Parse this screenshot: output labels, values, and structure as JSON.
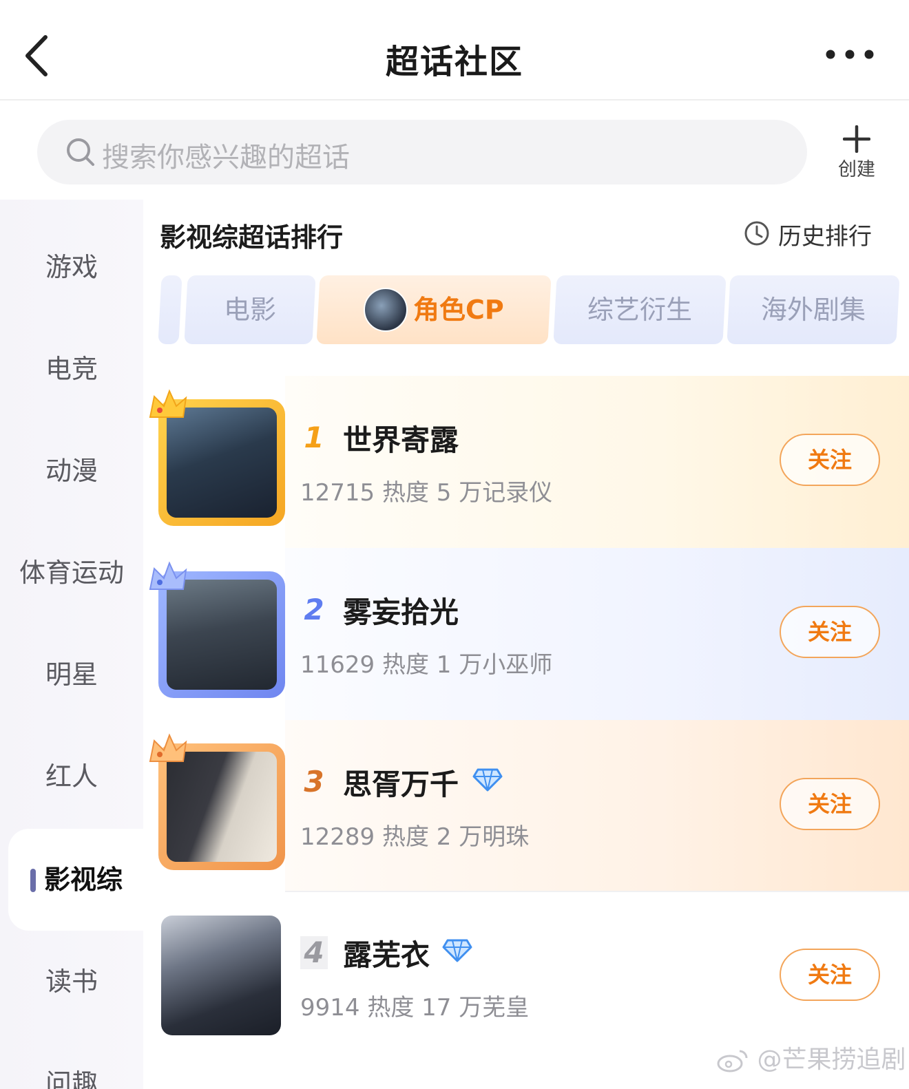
{
  "header": {
    "title": "超话社区"
  },
  "search": {
    "placeholder": "搜索你感兴趣的超话",
    "create_label": "创建"
  },
  "sidebar": {
    "items": [
      {
        "label": "游戏"
      },
      {
        "label": "电竞"
      },
      {
        "label": "动漫"
      },
      {
        "label": "体育运动"
      },
      {
        "label": "明星"
      },
      {
        "label": "红人"
      },
      {
        "label": "影视综",
        "active": true
      },
      {
        "label": "读书"
      },
      {
        "label": "问趣"
      }
    ]
  },
  "ranking": {
    "title": "影视综超话排行",
    "history_label": "历史排行",
    "tabs": [
      {
        "label": ""
      },
      {
        "label": "电影"
      },
      {
        "label": "角色CP",
        "active": true
      },
      {
        "label": "综艺衍生"
      },
      {
        "label": "海外剧集"
      }
    ],
    "items": [
      {
        "rank": "1",
        "name": "世界寄露",
        "stats": "12715 热度 5 万记录仪",
        "follow_label": "关注"
      },
      {
        "rank": "2",
        "name": "雾妄拾光",
        "stats": "11629 热度 1 万小巫师",
        "follow_label": "关注"
      },
      {
        "rank": "3",
        "name": "思胥万千",
        "stats": "12289 热度 2 万明珠",
        "follow_label": "关注",
        "badge": "diamond-badge"
      },
      {
        "rank": "4",
        "name": "露芜衣",
        "stats": "9914 热度 17 万芜皇",
        "follow_label": "关注",
        "badge": "diamond-badge"
      }
    ]
  },
  "watermark": "@芒果捞追剧",
  "colors": {
    "accent_orange": "#f07a12",
    "gold": "#f5a018",
    "silver_blue": "#5f7df0",
    "bronze": "#d8742a",
    "sidebar_bar": "#6a6ea9"
  }
}
